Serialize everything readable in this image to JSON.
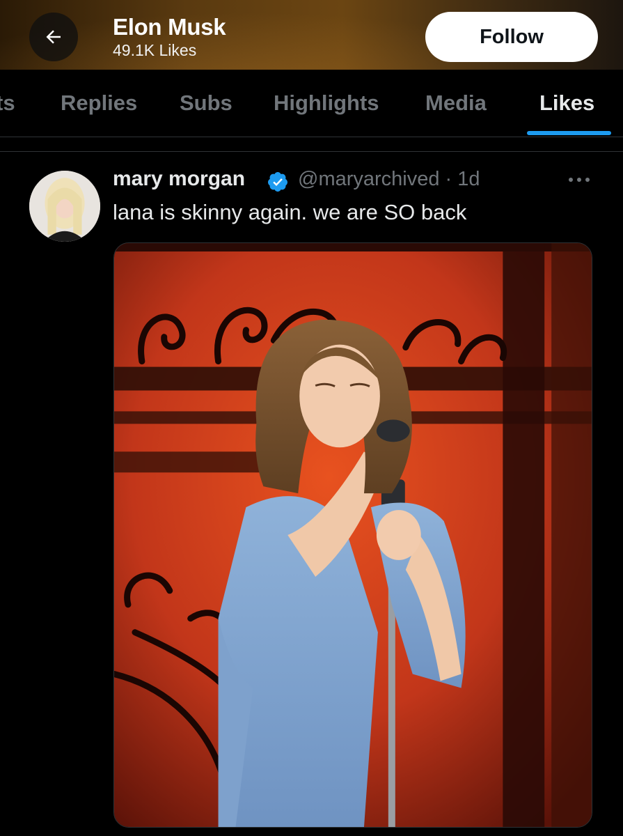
{
  "header": {
    "title": "Elon Musk",
    "subtitle": "49.1K Likes",
    "follow_label": "Follow",
    "back_icon": "arrow-left-icon"
  },
  "tabs": [
    {
      "label": "ts",
      "active": false
    },
    {
      "label": "Replies",
      "active": false
    },
    {
      "label": "Subs",
      "active": false
    },
    {
      "label": "Highlights",
      "active": false
    },
    {
      "label": "Media",
      "active": false
    },
    {
      "label": "Likes",
      "active": true
    }
  ],
  "tweet": {
    "author_name": "mary morgan",
    "verified": true,
    "handle_time": "@maryarchived · 1d",
    "text": "lana is skinny again. we are SO back",
    "more_icon": "more-horizontal-icon"
  },
  "colors": {
    "accent": "#1d9bf0",
    "background": "#000000",
    "muted_text": "#71767b"
  }
}
